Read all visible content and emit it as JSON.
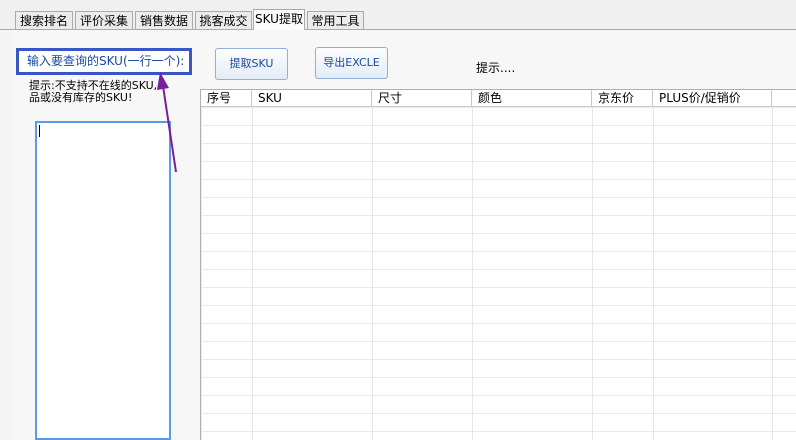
{
  "tabs": [
    {
      "label": "搜索排名",
      "active": false
    },
    {
      "label": "评价采集",
      "active": false
    },
    {
      "label": "销售数据",
      "active": false
    },
    {
      "label": "挑客成交",
      "active": false
    },
    {
      "label": "SKU提取",
      "active": true
    },
    {
      "label": "常用工具",
      "active": false
    }
  ],
  "left": {
    "input_label": "输入要查询的SKU(一行一个):",
    "hint_line1": "提示:不支持不在线的SKU,",
    "hint_line2": "品或没有库存的SKU!",
    "textarea_value": ""
  },
  "toolbar": {
    "extract_label": "提取SKU",
    "export_label": "导出EXCLE",
    "status_hint": "提示...."
  },
  "table": {
    "columns": [
      "序号",
      "SKU",
      "尺寸",
      "颜色",
      "京东价",
      "PLUS价/促销价"
    ],
    "rows": []
  },
  "colors": {
    "highlight_border": "#3a55c5",
    "arrow": "#7a1e9a",
    "textarea_border": "#5b9be3"
  }
}
